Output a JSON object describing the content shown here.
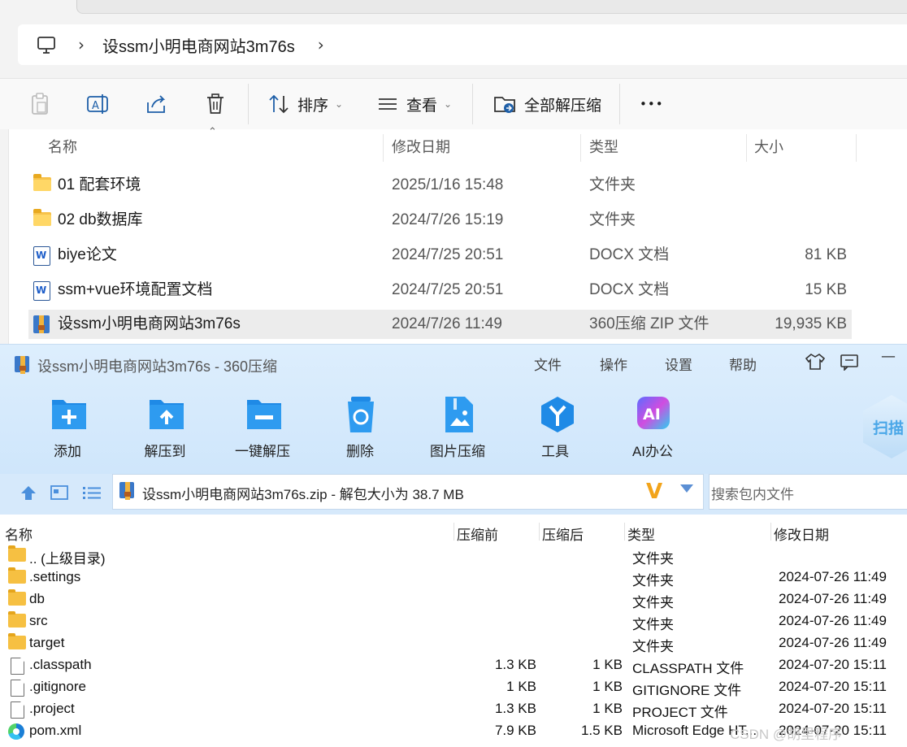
{
  "explorer": {
    "breadcrumb": "设ssm小明电商网站3m76s",
    "chevron": "›",
    "toolbar": {
      "sort_label": "排序",
      "view_label": "查看",
      "extract_all_label": "全部解压缩",
      "more_label": "•••"
    },
    "columns": {
      "name": "名称",
      "modified": "修改日期",
      "type": "类型",
      "size": "大小"
    },
    "files": [
      {
        "name": "01 配套环境",
        "modified": "2025/1/16 15:48",
        "type": "文件夹",
        "size": "",
        "icon": "folder-icon"
      },
      {
        "name": "02 db数据库",
        "modified": "2024/7/26 15:19",
        "type": "文件夹",
        "size": "",
        "icon": "folder-icon"
      },
      {
        "name": "biye论文",
        "modified": "2024/7/25 20:51",
        "type": "DOCX 文档",
        "size": "81 KB",
        "icon": "word-doc-icon"
      },
      {
        "name": "ssm+vue环境配置文档",
        "modified": "2024/7/25 20:51",
        "type": "DOCX 文档",
        "size": "15 KB",
        "icon": "word-doc-icon"
      },
      {
        "name": "设ssm小明电商网站3m76s",
        "modified": "2024/7/26 11:49",
        "type": "360压缩 ZIP 文件",
        "size": "19,935 KB",
        "icon": "zip-archive-icon",
        "selected": true
      }
    ]
  },
  "zip_window": {
    "title": "设ssm小明电商网站3m76s - 360压缩",
    "menu": [
      "文件",
      "操作",
      "设置",
      "帮助"
    ],
    "tools": [
      {
        "label": "添加",
        "icon": "add-icon"
      },
      {
        "label": "解压到",
        "icon": "extract-to-icon"
      },
      {
        "label": "一键解压",
        "icon": "one-click-extract-icon"
      },
      {
        "label": "删除",
        "icon": "delete-icon"
      },
      {
        "label": "图片压缩",
        "icon": "image-compress-icon"
      },
      {
        "label": "工具",
        "icon": "tools-icon"
      },
      {
        "label": "AI办公",
        "icon": "ai-office-icon"
      }
    ],
    "scan_label": "扫描",
    "path_text": "设ssm小明电商网站3m76s.zip - 解包大小为 38.7 MB",
    "search_placeholder": "搜索包内文件",
    "columns": {
      "name": "名称",
      "before": "压缩前",
      "after": "压缩后",
      "type": "类型",
      "modified": "修改日期"
    },
    "entries": [
      {
        "name": ".. (上级目录)",
        "before": "",
        "after": "",
        "type": "文件夹",
        "modified": "",
        "icon": "folder-icon"
      },
      {
        "name": ".settings",
        "before": "",
        "after": "",
        "type": "文件夹",
        "modified": "2024-07-26 11:49",
        "icon": "folder-icon"
      },
      {
        "name": "db",
        "before": "",
        "after": "",
        "type": "文件夹",
        "modified": "2024-07-26 11:49",
        "icon": "folder-icon"
      },
      {
        "name": "src",
        "before": "",
        "after": "",
        "type": "文件夹",
        "modified": "2024-07-26 11:49",
        "icon": "folder-icon"
      },
      {
        "name": "target",
        "before": "",
        "after": "",
        "type": "文件夹",
        "modified": "2024-07-26 11:49",
        "icon": "folder-icon"
      },
      {
        "name": ".classpath",
        "before": "1.3 KB",
        "after": "1 KB",
        "type": "CLASSPATH 文件",
        "modified": "2024-07-20 15:11",
        "icon": "file-icon"
      },
      {
        "name": ".gitignore",
        "before": "1 KB",
        "after": "1 KB",
        "type": "GITIGNORE 文件",
        "modified": "2024-07-20 15:11",
        "icon": "file-icon"
      },
      {
        "name": ".project",
        "before": "1.3 KB",
        "after": "1 KB",
        "type": "PROJECT 文件",
        "modified": "2024-07-20 15:11",
        "icon": "file-icon"
      },
      {
        "name": "pom.xml",
        "before": "7.9 KB",
        "after": "1.5 KB",
        "type": "Microsoft Edge HT...",
        "modified": "2024-07-20 15:11",
        "icon": "edge-icon"
      }
    ],
    "watermark": "CSDN @胡里程序"
  },
  "colors": {
    "accent_blue": "#1e88e5",
    "toolbar_bg": "#cfe6fb",
    "selected_row": "#ececec"
  }
}
